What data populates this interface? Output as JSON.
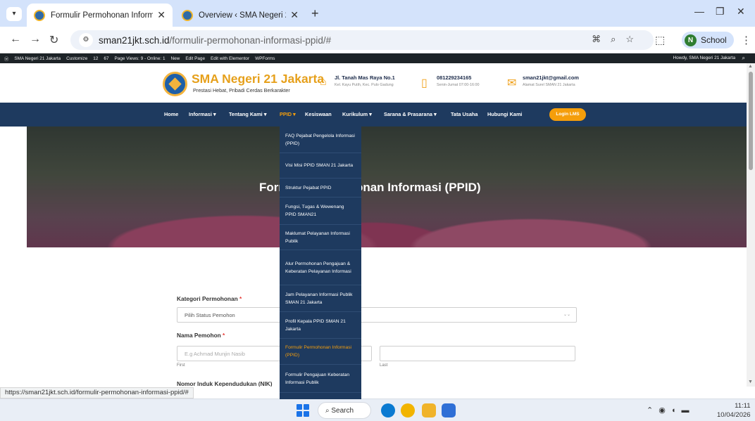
{
  "browser": {
    "tabs": [
      {
        "title": "Formulir Permohonan Informasi",
        "active": true
      },
      {
        "title": "Overview ‹ SMA Negeri 21 Jakarta",
        "active": false
      }
    ],
    "url_host": "sman21jkt.sch.id",
    "url_path": "/formulir-permohonan-informasi-ppid/#",
    "profile_initial": "N",
    "profile_label": "School"
  },
  "wp_admin_bar": {
    "items": [
      "SMA Negeri 21 Jakarta",
      "Customize",
      "12",
      "67",
      "Page Views: 9 - Online: 1",
      "New",
      "Edit Page",
      "Edit with Elementor",
      "WPForms"
    ],
    "howdy": "Howdy, SMA Negeri 21 Jakarta"
  },
  "header": {
    "school_name": "SMA Negeri 21 Jakarta",
    "tagline": "Prestasi Hebat, Pribadi Cerdas Berkarakter",
    "address_main": "Jl. Tanah Mas Raya No.1",
    "address_sub": "Kel. Kayu Putih, Kec. Pulo Gadung",
    "phone_main": "081229234165",
    "phone_sub": "Senin-Jumat 07:00-16:00",
    "email_main": "sman21jkt@gmail.com",
    "email_sub": "Alamat Surel SMAN 21 Jakarta"
  },
  "nav": {
    "items": [
      "Home",
      "Informasi ▾",
      "Tentang Kami ▾",
      "PPID ▾",
      "Kesiswaan",
      "Kurikulum ▾",
      "Sarana & Prasarana ▾",
      "Tata Usaha",
      "Hubungi Kami"
    ],
    "active_index": 3,
    "lms_button": "Login LMS"
  },
  "hero": {
    "title": "Formulir Permohonan Informasi (PPID)"
  },
  "dropdown": {
    "items": [
      "FAQ Pejabat Pengelola Informasi (PPID)",
      "Visi Misi PPID SMAN 21 Jakarta",
      "Struktur Pejabat PPID",
      "Fungsi, Tugas & Wewenang PPID SMAN21",
      "Maklumat Pelayanan Informasi Publik",
      "Alur Permohonan Pengajuan & Keberatan Pelayanan Informasi",
      "Jam Pelayanan Informasi Publik SMAN 21 Jakarta",
      "Profil Kepala PPID SMAN 21 Jakarta",
      "Formulir Permohonan Informasi (PPID)",
      "Formulir Pengajuan Keberatan Informasi Publik"
    ],
    "current_index": 8
  },
  "form": {
    "kategori_label": "Kategori Permohonan",
    "kategori_value": "Pilih Status Pemohon",
    "nama_label": "Nama Pemohon",
    "first_placeholder": "E.g Achmad Munjin Nasib",
    "first_sub": "First",
    "last_sub": "Last",
    "nik_label": "Nomor Induk Kependudukan (NIK)",
    "required_mark": "*"
  },
  "status_bar_url": "https://sman21jkt.sch.id/formulir-permohonan-informasi-ppid/#",
  "taskbar": {
    "search_label": "Search",
    "time": "11:11",
    "date": "10/04/2026"
  },
  "colors": {
    "navy": "#1e3a5f",
    "accent_orange": "#f59e0b",
    "brand_gold": "#e6a01b"
  }
}
